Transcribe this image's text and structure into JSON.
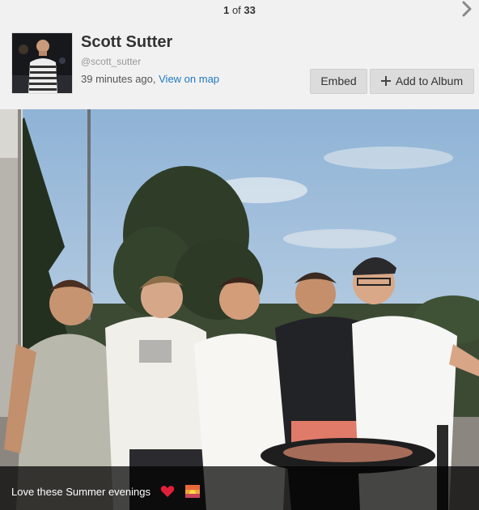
{
  "pager": {
    "current": "1",
    "separator": "of",
    "total": "33"
  },
  "profile": {
    "name": "Scott Sutter",
    "handle": "@scott_sutter",
    "time_ago": "39 minutes ago, ",
    "map_link": "View on map"
  },
  "actions": {
    "embed_label": "Embed",
    "add_album_label": "Add to Album"
  },
  "photo": {
    "caption": "Love these Summer evenings",
    "caption_emojis": [
      "heart-emoji",
      "sunset-emoji"
    ]
  },
  "colors": {
    "link": "#1f7ac4",
    "heart": "#e0203a",
    "caption_bg": "#000000"
  }
}
